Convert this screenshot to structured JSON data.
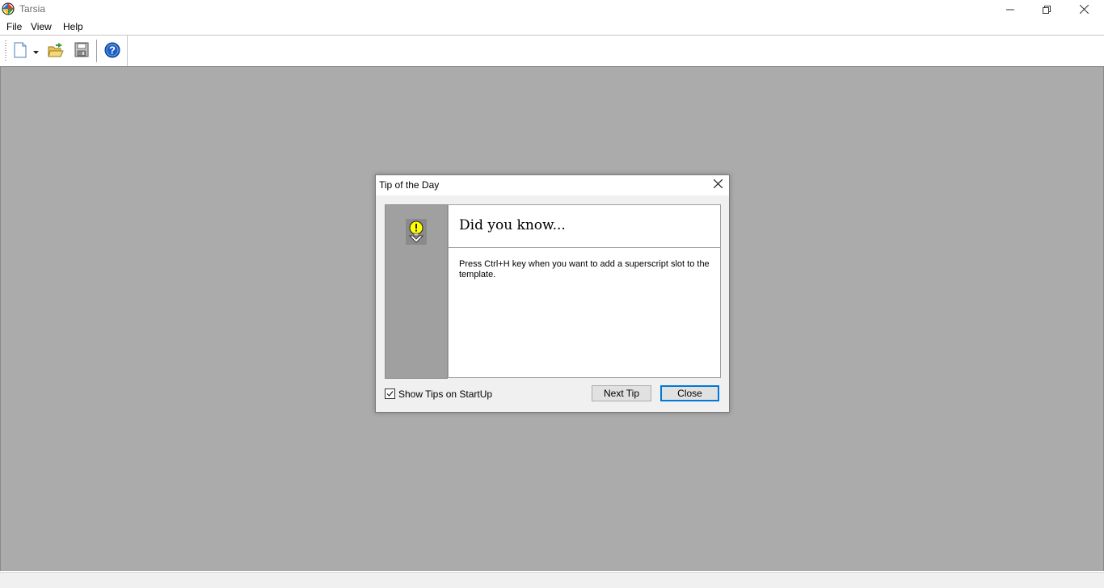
{
  "window": {
    "title": "Tarsia",
    "controls": [
      "minimize-icon",
      "restore-icon",
      "close-icon"
    ]
  },
  "menu": {
    "items": [
      {
        "label": "File"
      },
      {
        "label": "View"
      },
      {
        "label": "Help"
      }
    ]
  },
  "toolbar": {
    "buttons": [
      {
        "icon": "new-document-icon"
      },
      {
        "icon": "dropdown-arrow-icon"
      },
      {
        "icon": "open-folder-icon"
      },
      {
        "icon": "save-icon"
      },
      {
        "icon": "help-icon"
      }
    ]
  },
  "dialog": {
    "title": "Tip of the Day",
    "heading": "Did you know...",
    "tip_text": "Press Ctrl+H key when you want to add a superscript slot to the template.",
    "show_tips_label": "Show Tips on StartUp",
    "show_tips_checked": true,
    "next_tip_label": "Next Tip",
    "close_label": "Close",
    "icon": "lightbulb-icon"
  },
  "colors": {
    "workspace": "#ababab",
    "dialog_bg": "#f0f0f0",
    "tip_panel": "#a0a0a0",
    "focus_border": "#0078d7"
  }
}
